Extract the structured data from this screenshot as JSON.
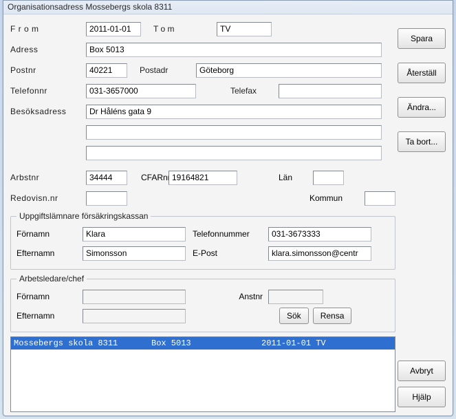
{
  "window": {
    "title": "Organisationsadress Mossebergs skola 8311"
  },
  "labels": {
    "from": "F r o m",
    "tom": "T o m",
    "adress": "Adress",
    "postnr": "Postnr",
    "postadr": "Postadr",
    "telefonnr": "Telefonnr",
    "telefax": "Telefax",
    "besoksadress": "Besöksadress",
    "arbstnr": "Arbstnr",
    "cfarnr": "CFARnr",
    "lan": "Län",
    "redovisnnr": "Redovisn.nr",
    "kommun": "Kommun"
  },
  "fields": {
    "from": "2011-01-01",
    "tom": "TV",
    "adress": "Box 5013",
    "postnr": "40221",
    "postadr": "Göteborg",
    "telefonnr": "031-3657000",
    "telefax": "",
    "besok1": "Dr Håléns gata 9",
    "besok2": "",
    "besok3": "",
    "arbstnr": "34444",
    "cfarnr": "19164821",
    "lan": "",
    "redovisnnr": "",
    "kommun": ""
  },
  "uppgift": {
    "legend": "Uppgiftslämnare försäkringskassan",
    "fornamn_label": "Förnamn",
    "efternamn_label": "Efternamn",
    "tel_label": "Telefonnummer",
    "epost_label": "E-Post",
    "fornamn": "Klara",
    "efternamn": "Simonsson",
    "tel": "031-3673333",
    "epost": "klara.simonsson@centr"
  },
  "chef": {
    "legend": "Arbetsledare/chef",
    "fornamn_label": "Förnamn",
    "efternamn_label": "Efternamn",
    "anstnr_label": "Anstnr",
    "fornamn": "",
    "efternamn": "",
    "anstnr": "",
    "sok": "Sök",
    "rensa": "Rensa"
  },
  "list": {
    "rows": [
      {
        "c1": "Mossebergs skola 8311",
        "c2": "Box 5013",
        "c3": "2011-01-01 TV"
      }
    ]
  },
  "buttons": {
    "spara": "Spara",
    "aterstall": "Återställ",
    "andra": "Ändra...",
    "tabort": "Ta bort...",
    "avbryt": "Avbryt",
    "hjalp": "Hjälp"
  }
}
